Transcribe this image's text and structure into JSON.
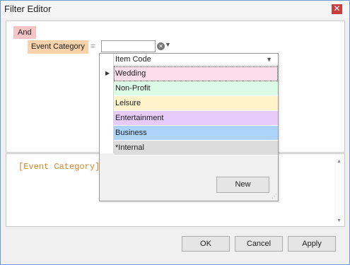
{
  "window": {
    "title": "Filter Editor",
    "close_glyph": "✕"
  },
  "tree": {
    "group_operator": "And",
    "field": "Event Category",
    "operator": "=",
    "value": "",
    "clear_glyph": "✕",
    "dropdown_glyph": "▼"
  },
  "expression": {
    "text": "[Event Category]"
  },
  "popup": {
    "column_header": "Item Code",
    "column_arrow_glyph": "▼",
    "current_row_glyph": "▶",
    "rows": [
      {
        "label": "Wedding",
        "color": "#f9dde9"
      },
      {
        "label": "Non-Profit",
        "color": "#dcfbe7"
      },
      {
        "label": "Leisure",
        "color": "#fff3cb"
      },
      {
        "label": "Entertainment",
        "color": "#e7cbfb"
      },
      {
        "label": "Business",
        "color": "#acd4fb"
      },
      {
        "label": "*Internal",
        "color": "#dcdcdc"
      }
    ],
    "new_button": "New",
    "grip_glyph": "⋰"
  },
  "scroll": {
    "up_glyph": "▲",
    "down_glyph": "▼"
  },
  "buttons": {
    "ok": "OK",
    "cancel": "Cancel",
    "apply": "Apply"
  },
  "colors": {
    "group_node": "#f5c5c5",
    "field_node": "#f8d2aa",
    "expression_text": "#d38427",
    "window_border": "#6e9bd1",
    "close_button": "#c93d3d"
  }
}
